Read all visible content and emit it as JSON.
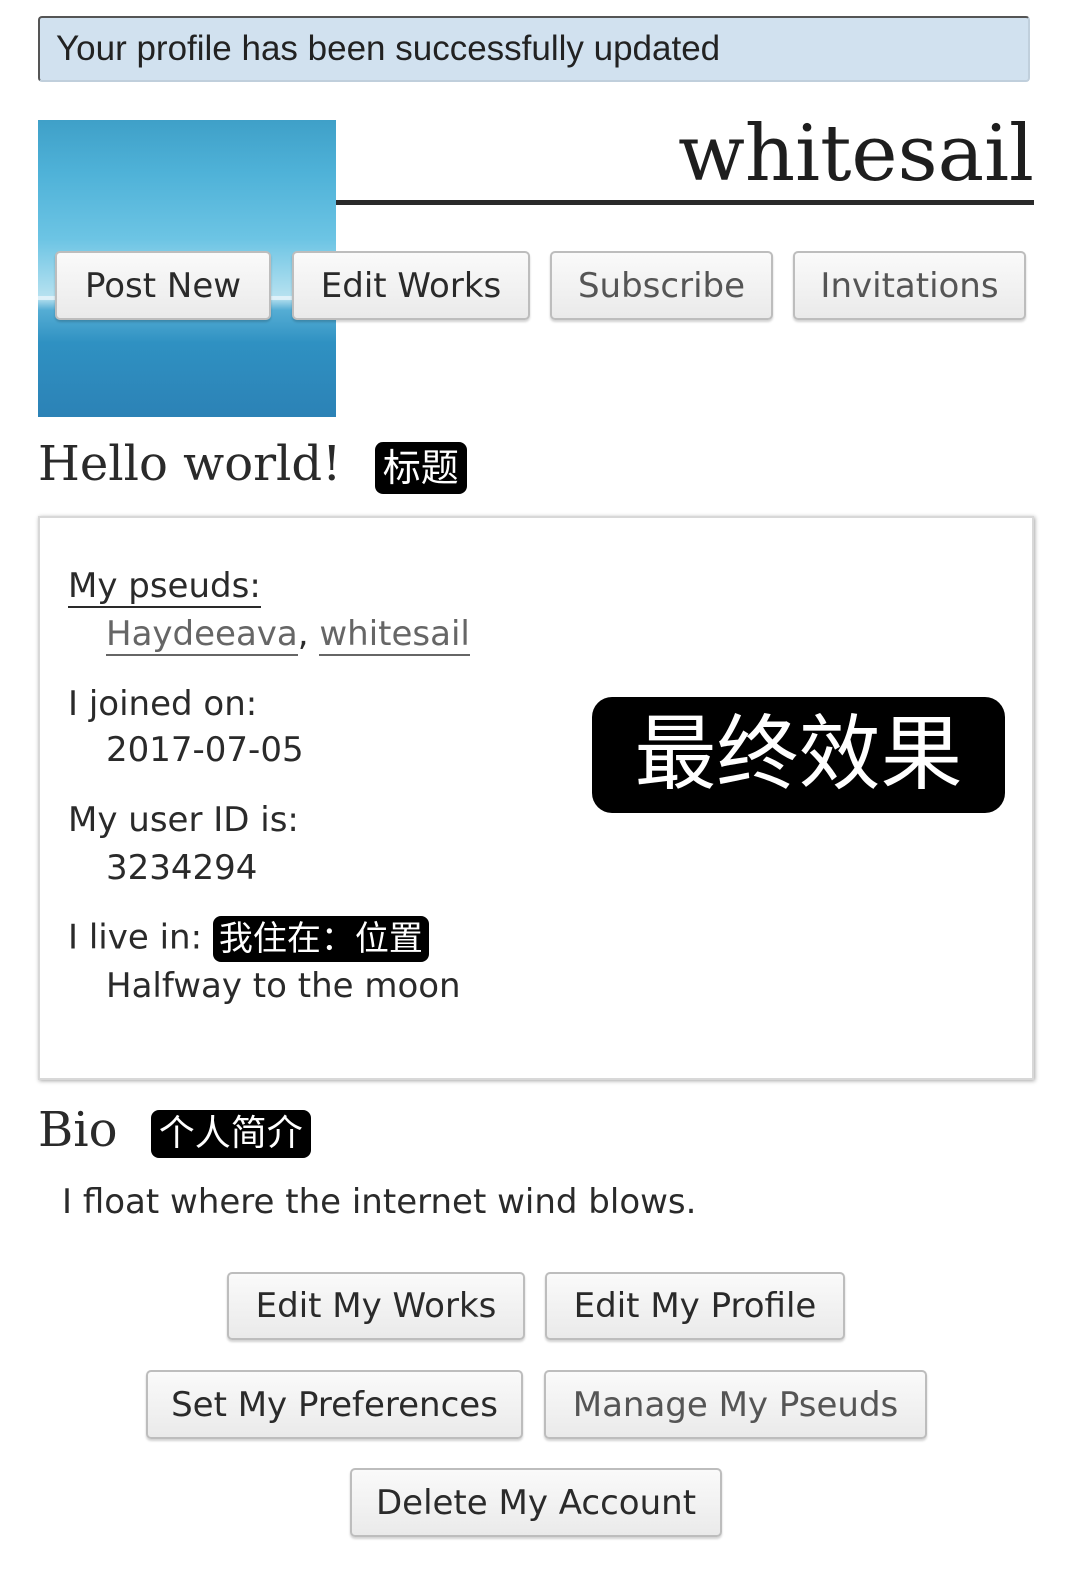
{
  "flash": {
    "message": "Your profile has been successfully updated"
  },
  "header": {
    "title": "whitesail"
  },
  "actions": {
    "post_new": "Post New",
    "edit_works": "Edit Works",
    "subscribe": "Subscribe",
    "invitations": "Invitations"
  },
  "intro": {
    "heading": "Hello world!",
    "tag": "标题"
  },
  "details": {
    "pseuds_label": "My pseuds:",
    "pseuds": [
      "Haydeeava",
      "whitesail"
    ],
    "pseuds_separator": ",",
    "joined_label": "I joined on:",
    "joined_value": "2017-07-05",
    "user_id_label": "My user ID is:",
    "user_id_value": "3234294",
    "location_label": "I live in:",
    "location_tag": "我住在：位置",
    "location_value": "Halfway to the moon",
    "overlay_tag": "最终效果"
  },
  "bio": {
    "heading": "Bio",
    "tag": "个人简介",
    "text": "I float where the internet wind blows."
  },
  "footer_actions": {
    "edit_my_works": "Edit My Works",
    "edit_my_profile": "Edit My Profile",
    "set_my_preferences": "Set My Preferences",
    "manage_my_pseuds": "Manage My Pseuds",
    "delete_my_account": "Delete My Account"
  }
}
